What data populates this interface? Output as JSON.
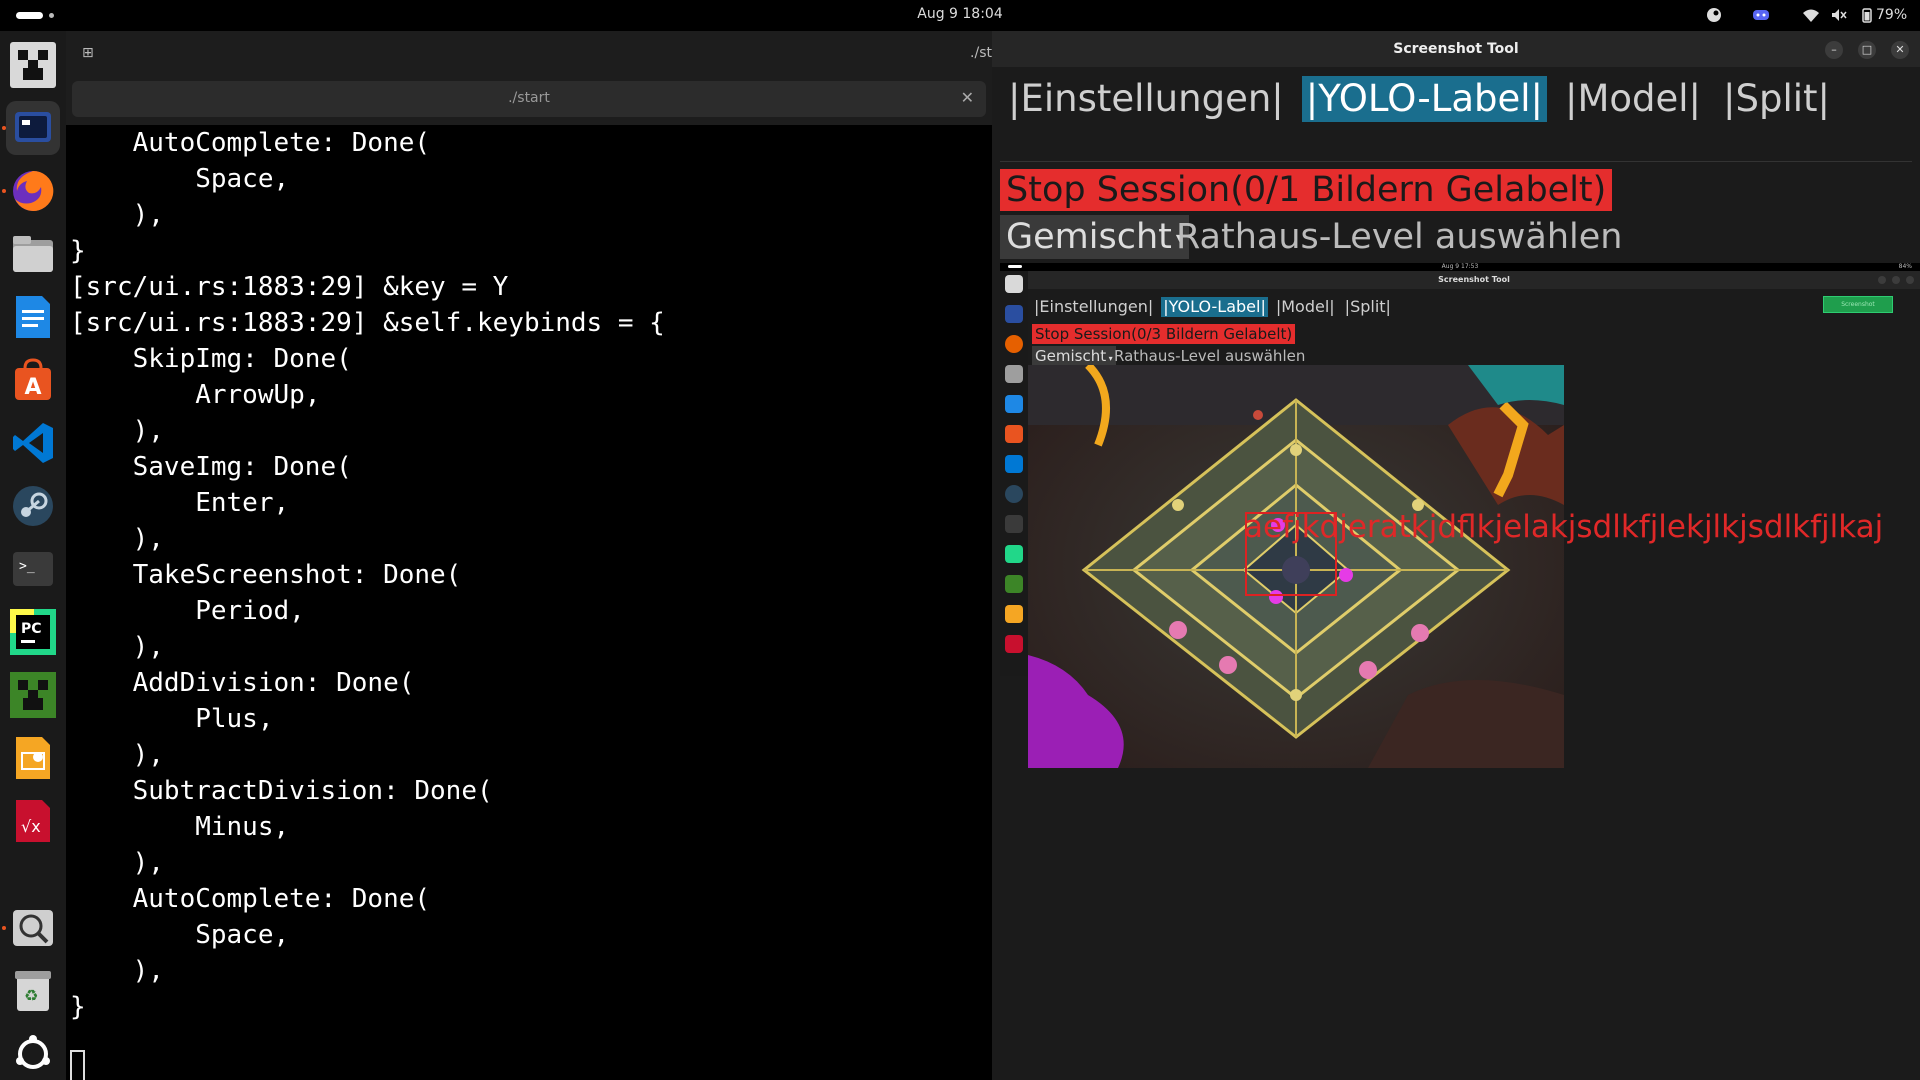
{
  "topbar": {
    "clock": "Aug 9  18:04",
    "battery": "79%",
    "icons": [
      "steam-tray-icon",
      "discord-tray-icon",
      "wifi-icon",
      "volume-muted-icon",
      "battery-icon"
    ]
  },
  "dock": {
    "apps": [
      {
        "name": "minecraft",
        "color": "#6b6b6b"
      },
      {
        "name": "terminal-app",
        "color": "#2a4ea0"
      },
      {
        "name": "firefox",
        "color": "#e66000"
      },
      {
        "name": "files",
        "color": "#8a8a8a"
      },
      {
        "name": "libreoffice-writer",
        "color": "#1e88e5"
      },
      {
        "name": "app-center",
        "color": "#e95420"
      },
      {
        "name": "vscode",
        "color": "#0078d4"
      },
      {
        "name": "steam",
        "color": "#1b2838"
      },
      {
        "name": "terminal",
        "color": "#3a3a3a"
      },
      {
        "name": "pycharm",
        "color": "#21d789"
      },
      {
        "name": "minecraft-launcher",
        "color": "#3c8527"
      },
      {
        "name": "libreoffice-impress",
        "color": "#f5a623"
      },
      {
        "name": "libreoffice-math",
        "color": "#c8102e"
      },
      {
        "name": "image-viewer",
        "color": "#cfcfcf"
      },
      {
        "name": "trash",
        "color": "#9e9e9e"
      },
      {
        "name": "ubuntu-show-apps",
        "color": "#ffffff"
      }
    ]
  },
  "terminal": {
    "header_title": "./st",
    "tab_label": "./start",
    "lines": [
      "    AutoComplete: Done(",
      "        Space,",
      "    ),",
      "}",
      "[src/ui.rs:1883:29] &key = Y",
      "[src/ui.rs:1883:29] &self.keybinds = {",
      "    SkipImg: Done(",
      "        ArrowUp,",
      "    ),",
      "    SaveImg: Done(",
      "        Enter,",
      "    ),",
      "    TakeScreenshot: Done(",
      "        Period,",
      "    ),",
      "    AddDivision: Done(",
      "        Plus,",
      "    ),",
      "    SubtractDivision: Done(",
      "        Minus,",
      "    ),",
      "    AutoComplete: Done(",
      "        Space,",
      "    ),",
      "}"
    ]
  },
  "app": {
    "title": "Screenshot Tool",
    "tabs": [
      {
        "label": "|Einstellungen|",
        "selected": false
      },
      {
        "label": "|YOLO-Label|",
        "selected": true
      },
      {
        "label": "|Model|",
        "selected": false
      },
      {
        "label": "|Split|",
        "selected": false
      }
    ],
    "stop_button": "Stop Session(0/1 Bildern Gelabelt)",
    "mode_select": "Gemischt",
    "level_placeholder": "Rathaus-Level auswählen",
    "accent_color": "#1a6e8e",
    "stop_color": "#e52d2d"
  },
  "preview": {
    "clock": "Aug 9  17:53",
    "tray": "84%",
    "title": "Screenshot Tool",
    "tabs": [
      {
        "label": "|Einstellungen|",
        "selected": false
      },
      {
        "label": "|YOLO-Label|",
        "selected": true
      },
      {
        "label": "|Model|",
        "selected": false
      },
      {
        "label": "|Split|",
        "selected": false
      }
    ],
    "stop_button": "Stop Session(0/3 Bildern Gelabelt)",
    "mode_select": "Gemischt",
    "level_placeholder": "Rathaus-Level auswählen",
    "green_button": "Screenshot",
    "overlay_text": "aefjkdjeratkjdflkjelakjsdlkfjlekjlkjsdlkfjlkaj"
  }
}
